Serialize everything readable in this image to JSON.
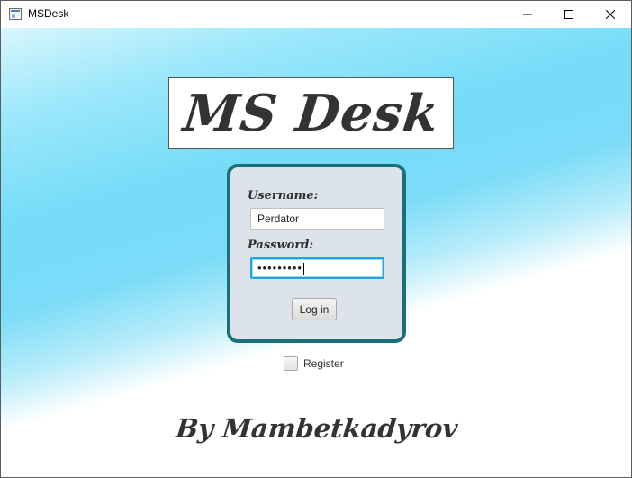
{
  "window": {
    "title": "MSDesk",
    "controls": {
      "minimize_icon": "minimize-icon",
      "maximize_icon": "maximize-icon",
      "close_icon": "close-icon"
    }
  },
  "logo": {
    "text": "MS Desk"
  },
  "login": {
    "username_label": "Username:",
    "username_value": "Perdator",
    "password_label": "Password:",
    "password_masked": "•••••••••",
    "login_button": "Log in"
  },
  "register": {
    "label": "Register",
    "checked": false
  },
  "footer": {
    "author": "By Mambetkadyrov"
  },
  "colors": {
    "panel_border": "#1a6f78",
    "panel_background": "#dde3ea",
    "focus_border": "#1fa6e0",
    "sky_blue": "#75dcf8"
  }
}
